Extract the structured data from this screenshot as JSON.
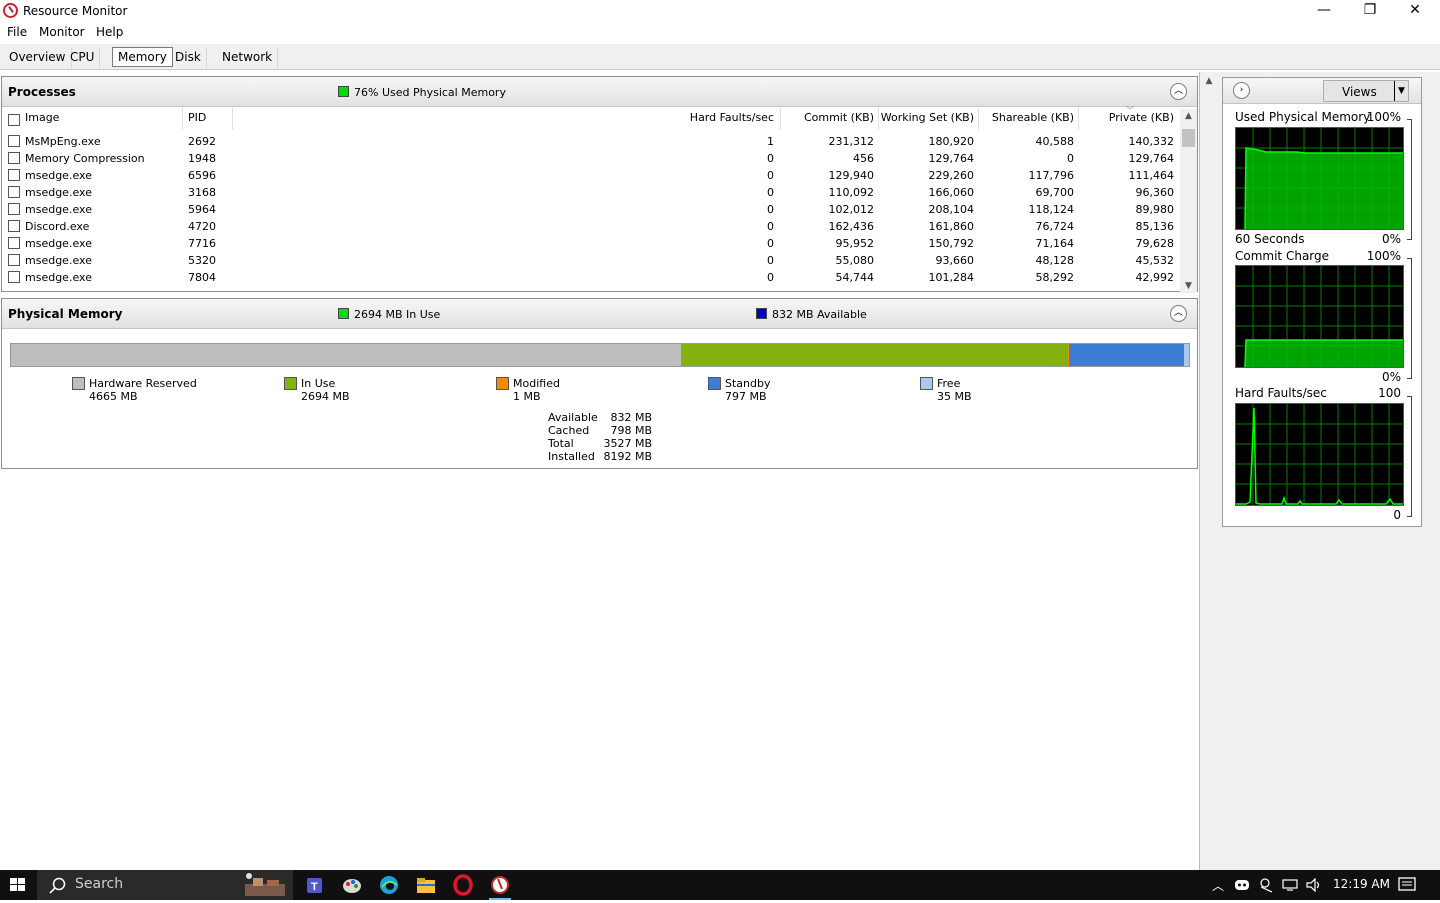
{
  "window": {
    "title": "Resource Monitor",
    "minimize": "—",
    "maximize": "❐",
    "close": "✕"
  },
  "menu": [
    "File",
    "Monitor",
    "Help"
  ],
  "tabs": [
    "Overview",
    "CPU",
    "Memory",
    "Disk",
    "Network"
  ],
  "active_tab": "Memory",
  "processes": {
    "title": "Processes",
    "stat": "76% Used Physical Memory",
    "stat_color": "#00e000",
    "columns": [
      "Image",
      "PID",
      "Hard Faults/sec",
      "Commit (KB)",
      "Working Set (KB)",
      "Shareable (KB)",
      "Private (KB)"
    ],
    "rows": [
      [
        "MsMpEng.exe",
        "2692",
        "1",
        "231,312",
        "180,920",
        "40,588",
        "140,332"
      ],
      [
        "Memory Compression",
        "1948",
        "0",
        "456",
        "129,764",
        "0",
        "129,764"
      ],
      [
        "msedge.exe",
        "6596",
        "0",
        "129,940",
        "229,260",
        "117,796",
        "111,464"
      ],
      [
        "msedge.exe",
        "3168",
        "0",
        "110,092",
        "166,060",
        "69,700",
        "96,360"
      ],
      [
        "msedge.exe",
        "5964",
        "0",
        "102,012",
        "208,104",
        "118,124",
        "89,980"
      ],
      [
        "Discord.exe",
        "4720",
        "0",
        "162,436",
        "161,860",
        "76,724",
        "85,136"
      ],
      [
        "msedge.exe",
        "7716",
        "0",
        "95,952",
        "150,792",
        "71,164",
        "79,628"
      ],
      [
        "msedge.exe",
        "5320",
        "0",
        "55,080",
        "93,660",
        "48,128",
        "45,532"
      ],
      [
        "msedge.exe",
        "7804",
        "0",
        "54,744",
        "101,284",
        "58,292",
        "42,992"
      ]
    ]
  },
  "physical_memory": {
    "title": "Physical Memory",
    "in_use_stat": "2694 MB In Use",
    "available_stat": "832 MB Available",
    "in_use_color": "#00e000",
    "available_color": "#0000c8",
    "segments": [
      {
        "name": "Hardware Reserved",
        "value": "4665 MB",
        "mb": 4665,
        "color": "#bebebe"
      },
      {
        "name": "In Use",
        "value": "2694 MB",
        "mb": 2694,
        "color": "#84b10d"
      },
      {
        "name": "Modified",
        "value": "1 MB",
        "mb": 1,
        "color": "#f08c00"
      },
      {
        "name": "Standby",
        "value": "797 MB",
        "mb": 797,
        "color": "#3c7dd6"
      },
      {
        "name": "Free",
        "value": "35 MB",
        "mb": 35,
        "color": "#a8c8ee"
      }
    ],
    "summary": [
      {
        "label": "Available",
        "value": "832 MB"
      },
      {
        "label": "Cached",
        "value": "798 MB"
      },
      {
        "label": "Total",
        "value": "3527 MB"
      },
      {
        "label": "Installed",
        "value": "8192 MB"
      }
    ]
  },
  "graphs": {
    "views_label": "Views",
    "items": [
      {
        "title": "Used Physical Memory",
        "max": "100%",
        "sub": "60 Seconds",
        "min": "0%"
      },
      {
        "title": "Commit Charge",
        "max": "100%",
        "min": "0%"
      },
      {
        "title": "Hard Faults/sec",
        "max": "100",
        "min": "0"
      }
    ]
  },
  "taskbar": {
    "search": "Search",
    "time": "12:19 AM"
  }
}
